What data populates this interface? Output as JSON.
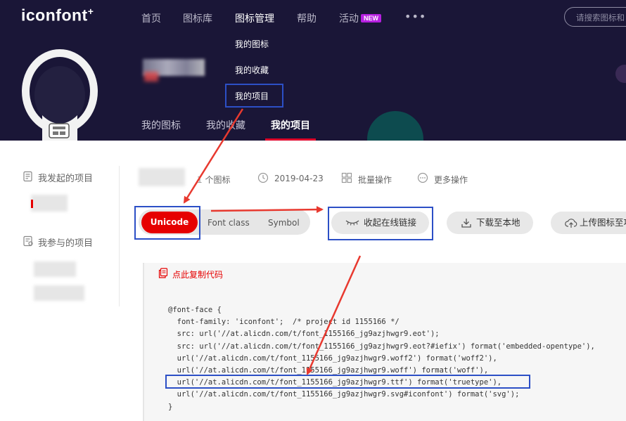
{
  "header": {
    "logo": "iconfont",
    "logo_plus": "+",
    "nav": [
      "首页",
      "图标库",
      "图标管理",
      "帮助",
      "活动"
    ],
    "nav_active_index": 2,
    "new_badge": "NEW",
    "more": "•••",
    "search_placeholder": "请搜索图标和",
    "dropdown": [
      "我的图标",
      "我的收藏",
      "我的项目"
    ],
    "sub_tabs": [
      "我的图标",
      "我的收藏",
      "我的项目"
    ],
    "sub_tab_active_index": 2
  },
  "sidebar": {
    "started_projects": "我发起的项目",
    "joined_projects": "我参与的项目"
  },
  "project": {
    "icon_count": "个图标",
    "date": "2019-04-23",
    "batch_ops": "批量操作",
    "more_ops": "更多操作"
  },
  "toggles": [
    "Unicode",
    "Font class",
    "Symbol"
  ],
  "toggle_active_index": 0,
  "actions": {
    "collapse_link": "收起在线链接",
    "download": "下载至本地",
    "upload": "上传图标至项"
  },
  "copy_code": "点此复制代码",
  "code_lines": [
    "@font-face {",
    "  font-family: 'iconfont';  /* project id 1155166 */",
    "  src: url('//at.alicdn.com/t/font_1155166_jg9azjhwgr9.eot');",
    "  src: url('//at.alicdn.com/t/font_1155166_jg9azjhwgr9.eot?#iefix') format('embedded-opentype'),",
    "  url('//at.alicdn.com/t/font_1155166_jg9azjhwgr9.woff2') format('woff2'),",
    "  url('//at.alicdn.com/t/font_1155166_jg9azjhwgr9.woff') format('woff'),",
    "  url('//at.alicdn.com/t/font_1155166_jg9azjhwgr9.ttf') format('truetype'),",
    "  url('//at.alicdn.com/t/font_1155166_jg9azjhwgr9.svg#iconfont') format('svg');",
    "}"
  ],
  "colors": {
    "header_bg": "#1a1637",
    "brand_red": "#e60000",
    "highlight_blue": "#2c4fc6",
    "badge_purple": "#b620e0"
  }
}
